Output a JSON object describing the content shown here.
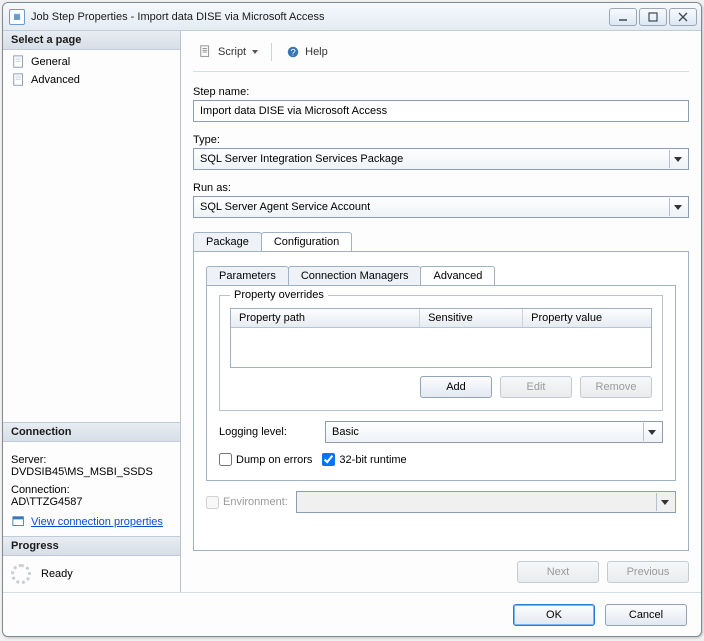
{
  "window": {
    "title": "Job Step Properties - Import data DISE via Microsoft Access"
  },
  "sidebar": {
    "header": "Select a page",
    "items": [
      {
        "label": "General"
      },
      {
        "label": "Advanced"
      }
    ]
  },
  "connection": {
    "header": "Connection",
    "server_label": "Server:",
    "server_value": "DVDSIB45\\MS_MSBI_SSDS",
    "conn_label": "Connection:",
    "conn_value": "AD\\TTZG4587",
    "view_link": "View connection properties"
  },
  "progress": {
    "header": "Progress",
    "status": "Ready"
  },
  "toolbar": {
    "script": "Script",
    "help": "Help"
  },
  "form": {
    "step_name_label": "Step name:",
    "step_name_value": "Import data DISE via Microsoft Access",
    "type_label": "Type:",
    "type_value": "SQL Server Integration Services Package",
    "runas_label": "Run as:",
    "runas_value": "SQL Server Agent Service Account"
  },
  "outer_tabs": {
    "package": "Package",
    "configuration": "Configuration"
  },
  "inner_tabs": {
    "parameters": "Parameters",
    "conn_mgrs": "Connection Managers",
    "advanced": "Advanced"
  },
  "overrides": {
    "group_title": "Property overrides",
    "col_path": "Property path",
    "col_sensitive": "Sensitive",
    "col_value": "Property value",
    "add": "Add",
    "edit": "Edit",
    "remove": "Remove"
  },
  "logging": {
    "label": "Logging level:",
    "value": "Basic",
    "dump": "Dump on errors",
    "runtime32": "32-bit runtime",
    "env_label": "Environment:"
  },
  "nav": {
    "next": "Next",
    "previous": "Previous"
  },
  "footer": {
    "ok": "OK",
    "cancel": "Cancel"
  }
}
